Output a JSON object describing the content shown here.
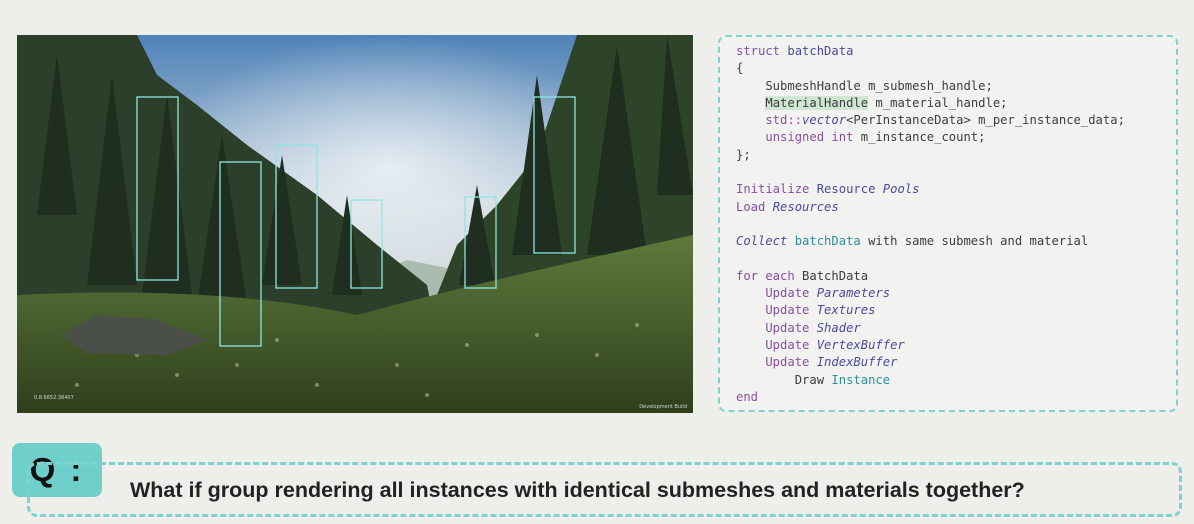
{
  "scene": {
    "version_text": "0.8.6652.38407",
    "build_text": "Development Build",
    "highlight_color": "#8ee6e2"
  },
  "code": {
    "lines": [
      [
        {
          "t": "struct ",
          "c": "kw"
        },
        {
          "t": "batchData",
          "c": "tp"
        }
      ],
      [
        {
          "t": "{",
          "c": "plain"
        }
      ],
      [
        {
          "t": "    SubmeshHandle m_submesh_handle;",
          "c": "plain"
        }
      ],
      [
        {
          "t": "    ",
          "c": "plain"
        },
        {
          "t": "MaterialHandle",
          "c": "hl"
        },
        {
          "t": " m_material_handle;",
          "c": "plain"
        }
      ],
      [
        {
          "t": "    std::",
          "c": "kw"
        },
        {
          "t": "vector",
          "c": "it"
        },
        {
          "t": "<PerInstanceData> m_per_instance_data;",
          "c": "plain"
        }
      ],
      [
        {
          "t": "    ",
          "c": "plain"
        },
        {
          "t": "unsigned int ",
          "c": "kw"
        },
        {
          "t": "m_instance_count;",
          "c": "plain"
        }
      ],
      [
        {
          "t": "};",
          "c": "plain"
        }
      ],
      [
        {
          "t": "",
          "c": "plain"
        }
      ],
      [
        {
          "t": "Initialize ",
          "c": "kw"
        },
        {
          "t": "Resource ",
          "c": "tp"
        },
        {
          "t": "Pools",
          "c": "it"
        }
      ],
      [
        {
          "t": "Load ",
          "c": "kw"
        },
        {
          "t": "Resources",
          "c": "it"
        }
      ],
      [
        {
          "t": "",
          "c": "plain"
        }
      ],
      [
        {
          "t": "Collect ",
          "c": "it"
        },
        {
          "t": "batchData ",
          "c": "cy"
        },
        {
          "t": "with same submesh and material",
          "c": "plain"
        }
      ],
      [
        {
          "t": "",
          "c": "plain"
        }
      ],
      [
        {
          "t": "for each ",
          "c": "kw"
        },
        {
          "t": "BatchData",
          "c": "plain"
        }
      ],
      [
        {
          "t": "    Update ",
          "c": "kw"
        },
        {
          "t": "Parameters",
          "c": "it"
        }
      ],
      [
        {
          "t": "    Update ",
          "c": "kw"
        },
        {
          "t": "Textures",
          "c": "it"
        }
      ],
      [
        {
          "t": "    Update ",
          "c": "kw"
        },
        {
          "t": "Shader",
          "c": "it"
        }
      ],
      [
        {
          "t": "    Update ",
          "c": "kw"
        },
        {
          "t": "VertexBuffer",
          "c": "it"
        }
      ],
      [
        {
          "t": "    Update ",
          "c": "kw"
        },
        {
          "t": "IndexBuffer",
          "c": "it"
        }
      ],
      [
        {
          "t": "        Draw ",
          "c": "plain"
        },
        {
          "t": "Instance",
          "c": "cy"
        }
      ],
      [
        {
          "t": "end",
          "c": "kw"
        }
      ]
    ]
  },
  "question": {
    "badge": "Q :",
    "text": "What if group rendering all instances with identical submeshes and materials together?"
  }
}
